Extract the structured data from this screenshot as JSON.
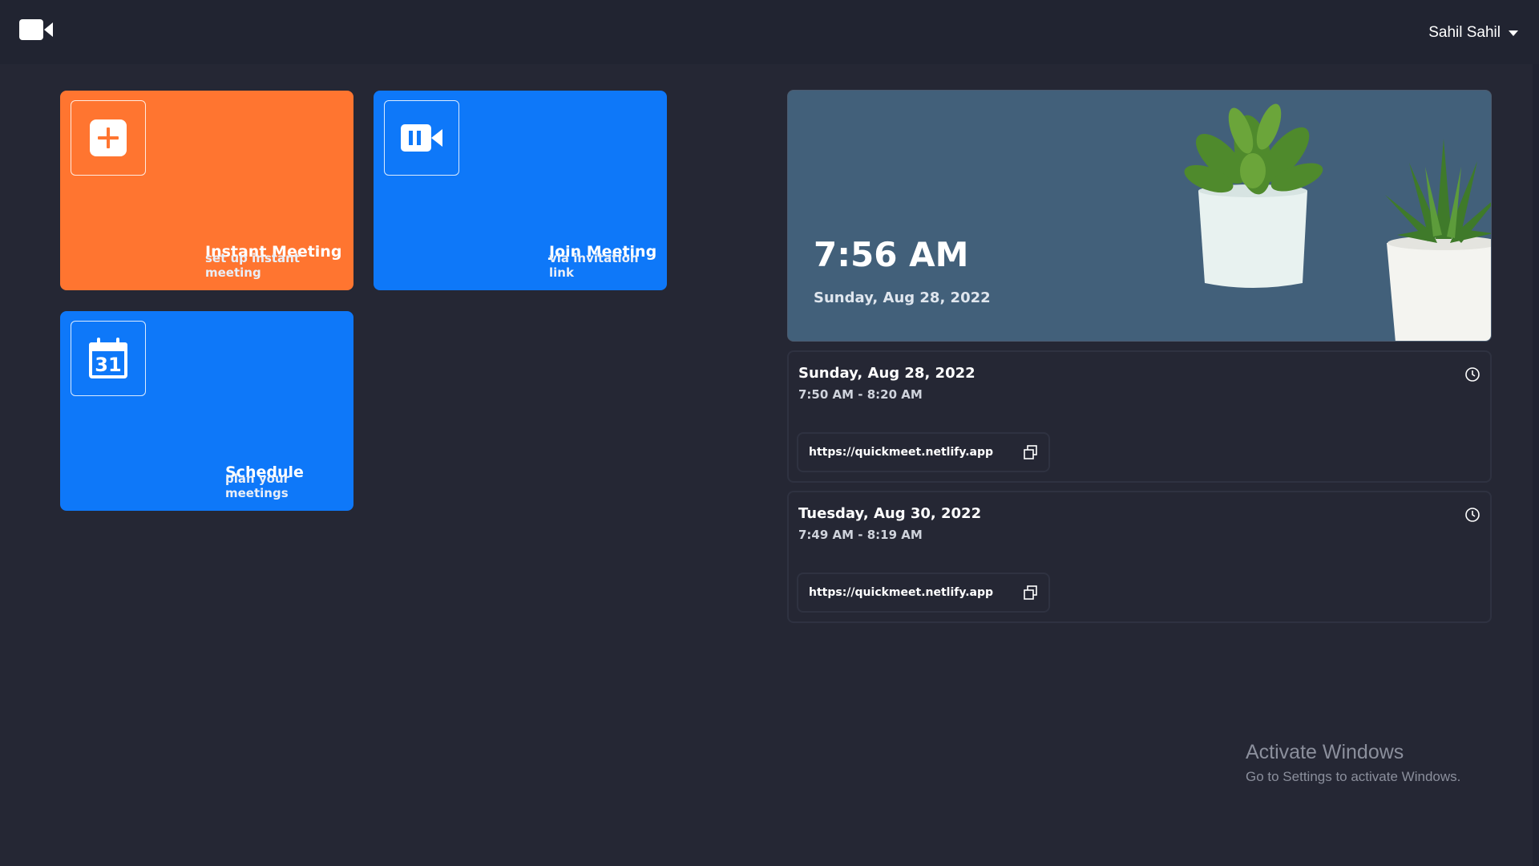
{
  "topbar": {
    "logo_icon": "video-camera-icon",
    "user_name": "Sahil Sahil"
  },
  "tiles": [
    {
      "title": "Instant Meeting",
      "subtitle": "set up instant meeting",
      "icon": "plus-icon",
      "color": "#ff7530"
    },
    {
      "title": "Join Meeting",
      "subtitle": "via invitation link",
      "icon": "video-camera-icon",
      "color": "#0e78f9"
    },
    {
      "title": "Schedule",
      "subtitle": "plan your meetings",
      "icon": "calendar-icon",
      "icon_text": "31",
      "color": "#0e78f9"
    }
  ],
  "hero": {
    "time": "7:56 AM",
    "date": "Sunday, Aug 28, 2022"
  },
  "meetings": [
    {
      "date": "Sunday, Aug 28, 2022",
      "time": "7:50 AM - 8:20 AM",
      "link": "https://quickmeet.netlify.app"
    },
    {
      "date": "Tuesday, Aug 30, 2022",
      "time": "7:49 AM - 8:19 AM",
      "link": "https://quickmeet.netlify.app"
    }
  ],
  "watermark": {
    "line1": "Activate Windows",
    "line2": "Go to Settings to activate Windows."
  }
}
